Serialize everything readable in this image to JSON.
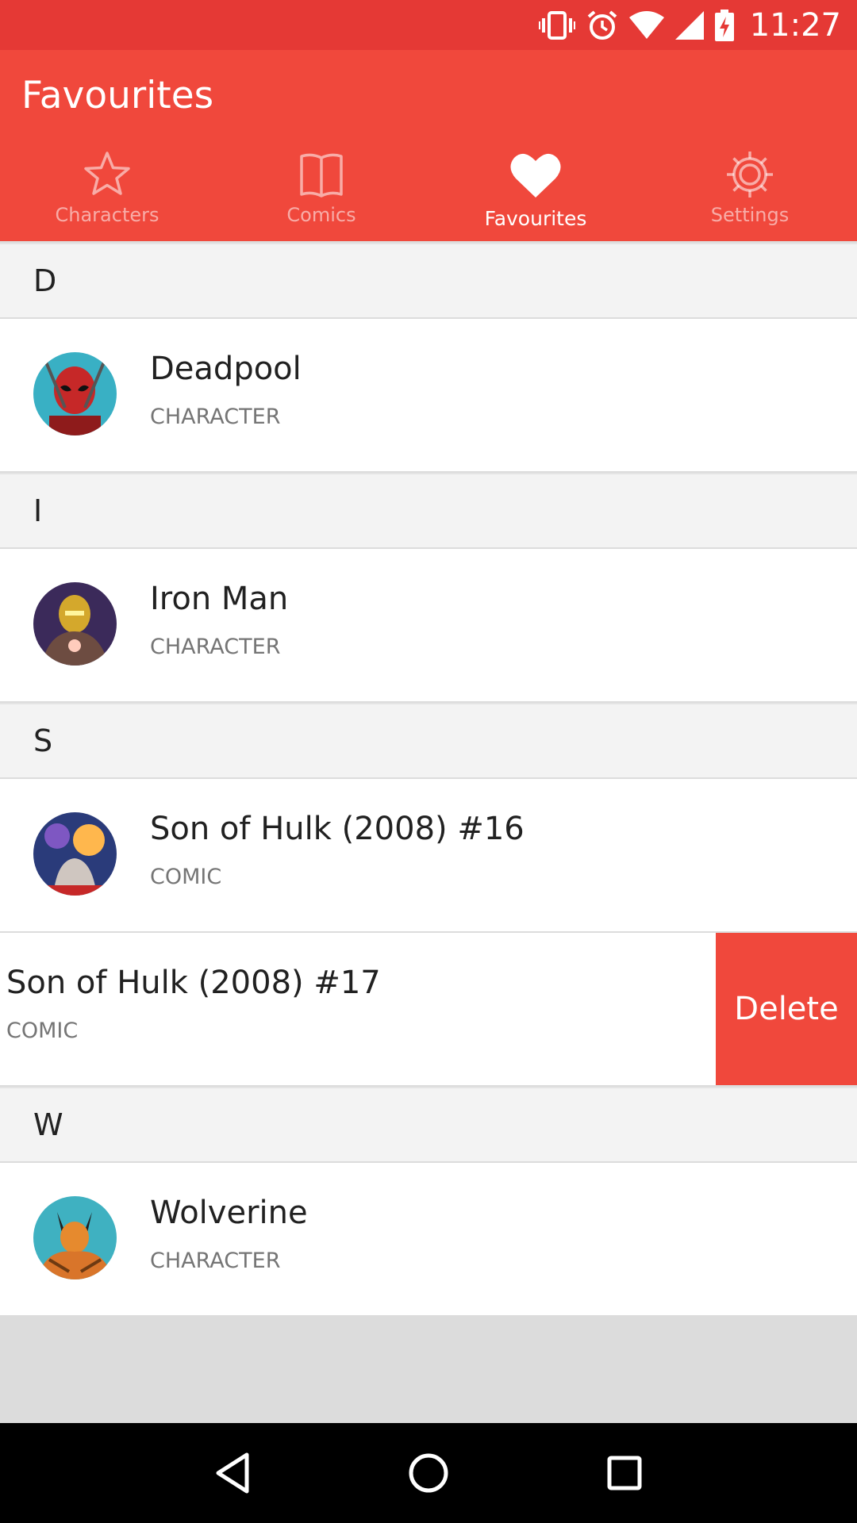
{
  "status": {
    "time": "11:27"
  },
  "app": {
    "title": "Favourites"
  },
  "tabs": [
    {
      "label": "Characters",
      "icon": "star-icon",
      "active": false
    },
    {
      "label": "Comics",
      "icon": "book-icon",
      "active": false
    },
    {
      "label": "Favourites",
      "icon": "heart-icon",
      "active": true
    },
    {
      "label": "Settings",
      "icon": "gear-icon",
      "active": false
    }
  ],
  "sections": [
    {
      "letter": "D",
      "items": [
        {
          "title": "Deadpool",
          "type": "CHARACTER"
        }
      ]
    },
    {
      "letter": "I",
      "items": [
        {
          "title": "Iron Man",
          "type": "CHARACTER"
        }
      ]
    },
    {
      "letter": "S",
      "items": [
        {
          "title": "Son of Hulk (2008) #16",
          "type": "COMIC"
        },
        {
          "title": "Son of Hulk (2008) #17",
          "type": "COMIC",
          "action": "Delete"
        }
      ]
    },
    {
      "letter": "W",
      "items": [
        {
          "title": "Wolverine",
          "type": "CHARACTER"
        }
      ]
    }
  ],
  "colors": {
    "primary": "#f0483c",
    "status": "#e53935"
  }
}
